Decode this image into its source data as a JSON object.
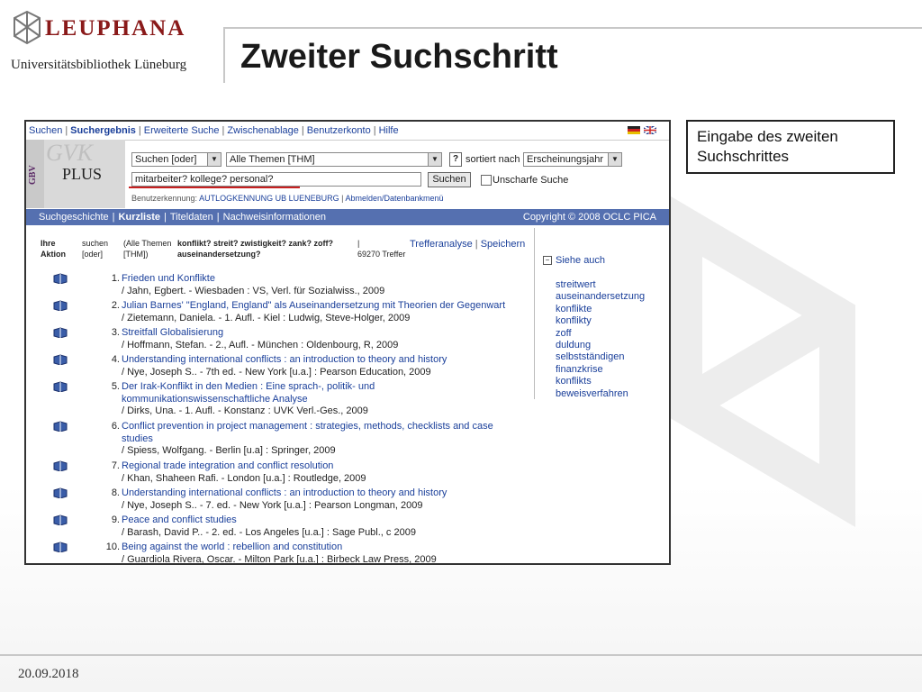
{
  "slide": {
    "logo_text": "LEUPHANA",
    "library_name": "Universitätsbibliothek Lüneburg",
    "title": "Zweiter Suchschritt",
    "callout": "Eingabe des zweiten Suchschrittes",
    "date": "20.09.2018"
  },
  "app": {
    "topnav": [
      "Suchen",
      "Suchergebnis",
      "Erweiterte Suche",
      "Zwischenablage",
      "Benutzerkonto",
      "Hilfe"
    ],
    "brand": {
      "gbv": "GBV",
      "gvk": "GVK",
      "plus": "PLUS"
    },
    "search": {
      "mode": "Suchen [oder]",
      "scope": "Alle Themen [THM]",
      "help": "?",
      "sort_label": "sortiert nach",
      "sort_value": "Erscheinungsjahr",
      "query": "mitarbeiter? kollege? personal?",
      "submit": "Suchen",
      "fuzzy_label": "Unscharfe Suche"
    },
    "user": {
      "label": "Benutzerkennung:",
      "name": "AUTLOGKENNUNG UB LUENEBURG",
      "sep": "|",
      "logout": "Abmelden/Datenbankmenü"
    },
    "subnav": [
      "Suchgeschichte",
      "Kurzliste",
      "Titeldaten",
      "Nachweisinformationen"
    ],
    "copyright": "Copyright © 2008 OCLC PICA",
    "results_header": {
      "col1_a": "Ihre",
      "col1_b": "Aktion",
      "col2_a": "suchen",
      "col2_b": "[oder]",
      "col3_a": "(Alle Themen",
      "col3_b": "[THM])",
      "query_a": "konflikt? streit? zwistigkeit? zank? zoff?",
      "query_b": "auseinandersetzung?",
      "pipe": "|",
      "hits": "69270 Treffer",
      "analysis": "Trefferanalyse",
      "save": "Speichern"
    },
    "see_also": {
      "label": "Siehe auch",
      "items": [
        "streitwert",
        "auseinandersetzung",
        "konflikte",
        "konflikty",
        "zoff",
        "duldung",
        "selbstständigen",
        "finanzkrise",
        "konflikts",
        "beweisverfahren"
      ]
    },
    "results": [
      {
        "num": "1.",
        "title": "Frieden und Konflikte",
        "meta": "/ Jahn, Egbert. - Wiesbaden : VS, Verl. für Sozialwiss., 2009"
      },
      {
        "num": "2.",
        "title": "Julian Barnes' \"England, England\" als Auseinandersetzung mit Theorien der Gegenwart",
        "meta": "/ Zietemann, Daniela. - 1. Aufl. - Kiel : Ludwig, Steve-Holger, 2009"
      },
      {
        "num": "3.",
        "title": "Streitfall Globalisierung",
        "meta": "/ Hoffmann, Stefan. - 2., Aufl. - München : Oldenbourg, R, 2009"
      },
      {
        "num": "4.",
        "title": "Understanding international conflicts : an introduction to theory and history",
        "meta": "/ Nye, Joseph S.. - 7th ed. - New York [u.a.] : Pearson Education, 2009"
      },
      {
        "num": "5.",
        "title": "Der Irak-Konflikt in den Medien : Eine sprach-, politik- und kommunikationswissenschaftliche Analyse",
        "meta": "/ Dirks, Una. - 1. Aufl. - Konstanz : UVK Verl.-Ges., 2009"
      },
      {
        "num": "6.",
        "title": "Conflict prevention in project management : strategies, methods, checklists and case studies",
        "meta": "/ Spiess, Wolfgang. - Berlin [u.a] : Springer, 2009"
      },
      {
        "num": "7.",
        "title": "Regional trade integration and conflict resolution",
        "meta": "/ Khan, Shaheen Rafi. - London [u.a.] : Routledge, 2009"
      },
      {
        "num": "8.",
        "title": "Understanding international conflicts : an introduction to theory and history",
        "meta": "/ Nye, Joseph S.. - 7. ed. - New York [u.a.] : Pearson Longman, 2009"
      },
      {
        "num": "9.",
        "title": "Peace and conflict studies",
        "meta": "/ Barash, David P.. - 2. ed. - Los Angeles [u.a.] : Sage Publ., c 2009"
      },
      {
        "num": "10.",
        "title": "Being against the world : rebellion and constitution",
        "meta": "/ Guardiola Rivera, Oscar. - Milton Park [u.a.] : Birbeck Law Press, 2009"
      }
    ]
  }
}
